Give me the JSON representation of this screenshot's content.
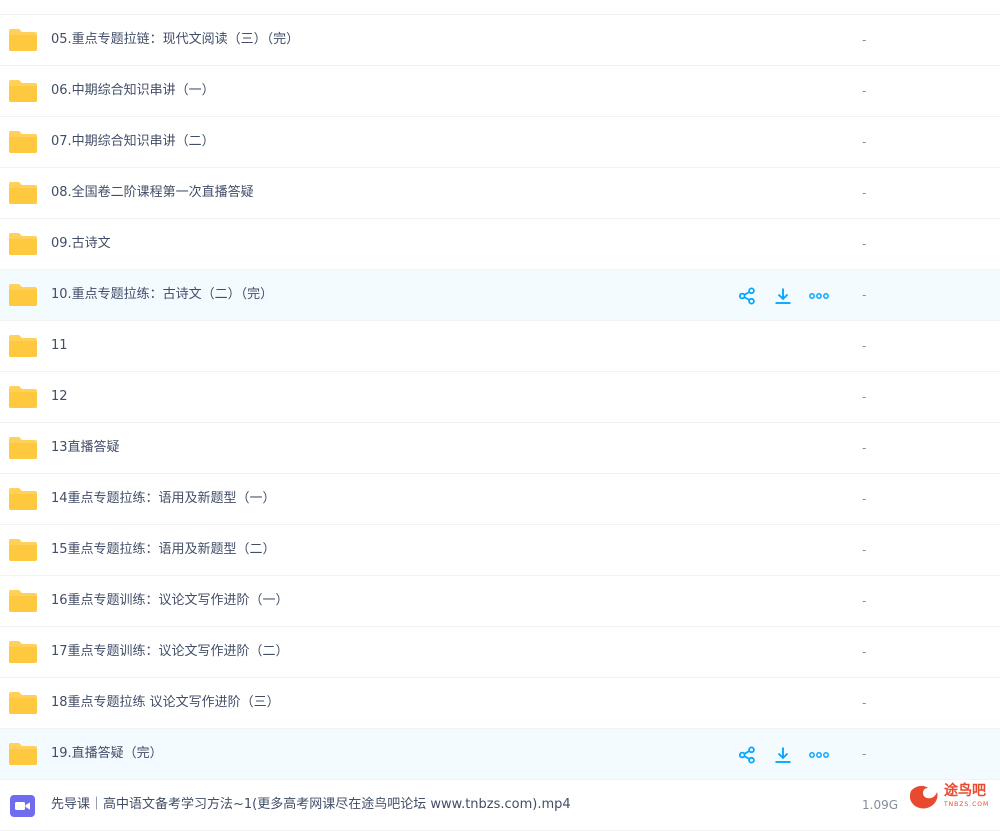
{
  "rows": [
    {
      "name": "",
      "size": "-"
    },
    {
      "name": "05.重点专题拉链：现代文阅读（三）（完）",
      "size": "-"
    },
    {
      "name": "06.中期综合知识串讲（一）",
      "size": "-"
    },
    {
      "name": "07.中期综合知识串讲（二）",
      "size": "-"
    },
    {
      "name": "08.全国卷二阶课程第一次直播答疑",
      "size": "-"
    },
    {
      "name": "09.古诗文",
      "size": "-"
    },
    {
      "name": "10.重点专题拉练：古诗文（二）（完）",
      "size": "-"
    },
    {
      "name": "11",
      "size": "-"
    },
    {
      "name": "12",
      "size": "-"
    },
    {
      "name": "13直播答疑",
      "size": "-"
    },
    {
      "name": "14重点专题拉练：语用及新题型（一）",
      "size": "-"
    },
    {
      "name": "15重点专题拉练：语用及新题型（二）",
      "size": "-"
    },
    {
      "name": "16重点专题训练：议论文写作进阶（一）",
      "size": "-"
    },
    {
      "name": "17重点专题训练：议论文写作进阶（二）",
      "size": "-"
    },
    {
      "name": "18重点专题拉练 议论文写作进阶（三）",
      "size": "-"
    },
    {
      "name": "19.直播答疑（完）",
      "size": "-"
    },
    {
      "name": "先导课｜高中语文备考学习方法~1(更多高考网课尽在途鸟吧论坛 www.tnbzs.com).mp4",
      "size": "1.09G"
    }
  ],
  "icons": {
    "folder": "folder-icon",
    "video": "video-file-icon",
    "share": "share-icon",
    "download": "download-icon",
    "more": "more-icon"
  },
  "colors": {
    "folder": "#ffd05a",
    "accent": "#06a7ff",
    "video": "#6f6cf0",
    "hover_bg": "#f4fbff"
  },
  "watermark": {
    "text": "途鸟吧",
    "sub": "TNBZS.COM"
  }
}
